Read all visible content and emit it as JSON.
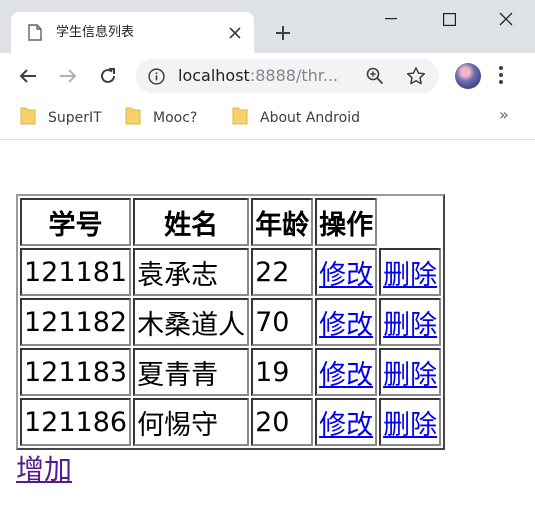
{
  "browser": {
    "tab_title": "学生信息列表",
    "url_host": "localhost",
    "url_rest": ":8888/thr...",
    "bookmarks": [
      {
        "label": "SuperIT"
      },
      {
        "label": "Mooc?"
      },
      {
        "label": "About Android"
      }
    ],
    "more_bookmarks": "»"
  },
  "table": {
    "headers": [
      "学号",
      "姓名",
      "年龄",
      "操作"
    ],
    "rows": [
      {
        "id": "121181",
        "name": "袁承志",
        "age": "22",
        "edit": "修改",
        "delete": "删除"
      },
      {
        "id": "121182",
        "name": "木桑道人",
        "age": "70",
        "edit": "修改",
        "delete": "删除"
      },
      {
        "id": "121183",
        "name": "夏青青",
        "age": "19",
        "edit": "修改",
        "delete": "删除"
      },
      {
        "id": "121186",
        "name": "何惕守",
        "age": "20",
        "edit": "修改",
        "delete": "删除"
      }
    ]
  },
  "add_link": "增加"
}
